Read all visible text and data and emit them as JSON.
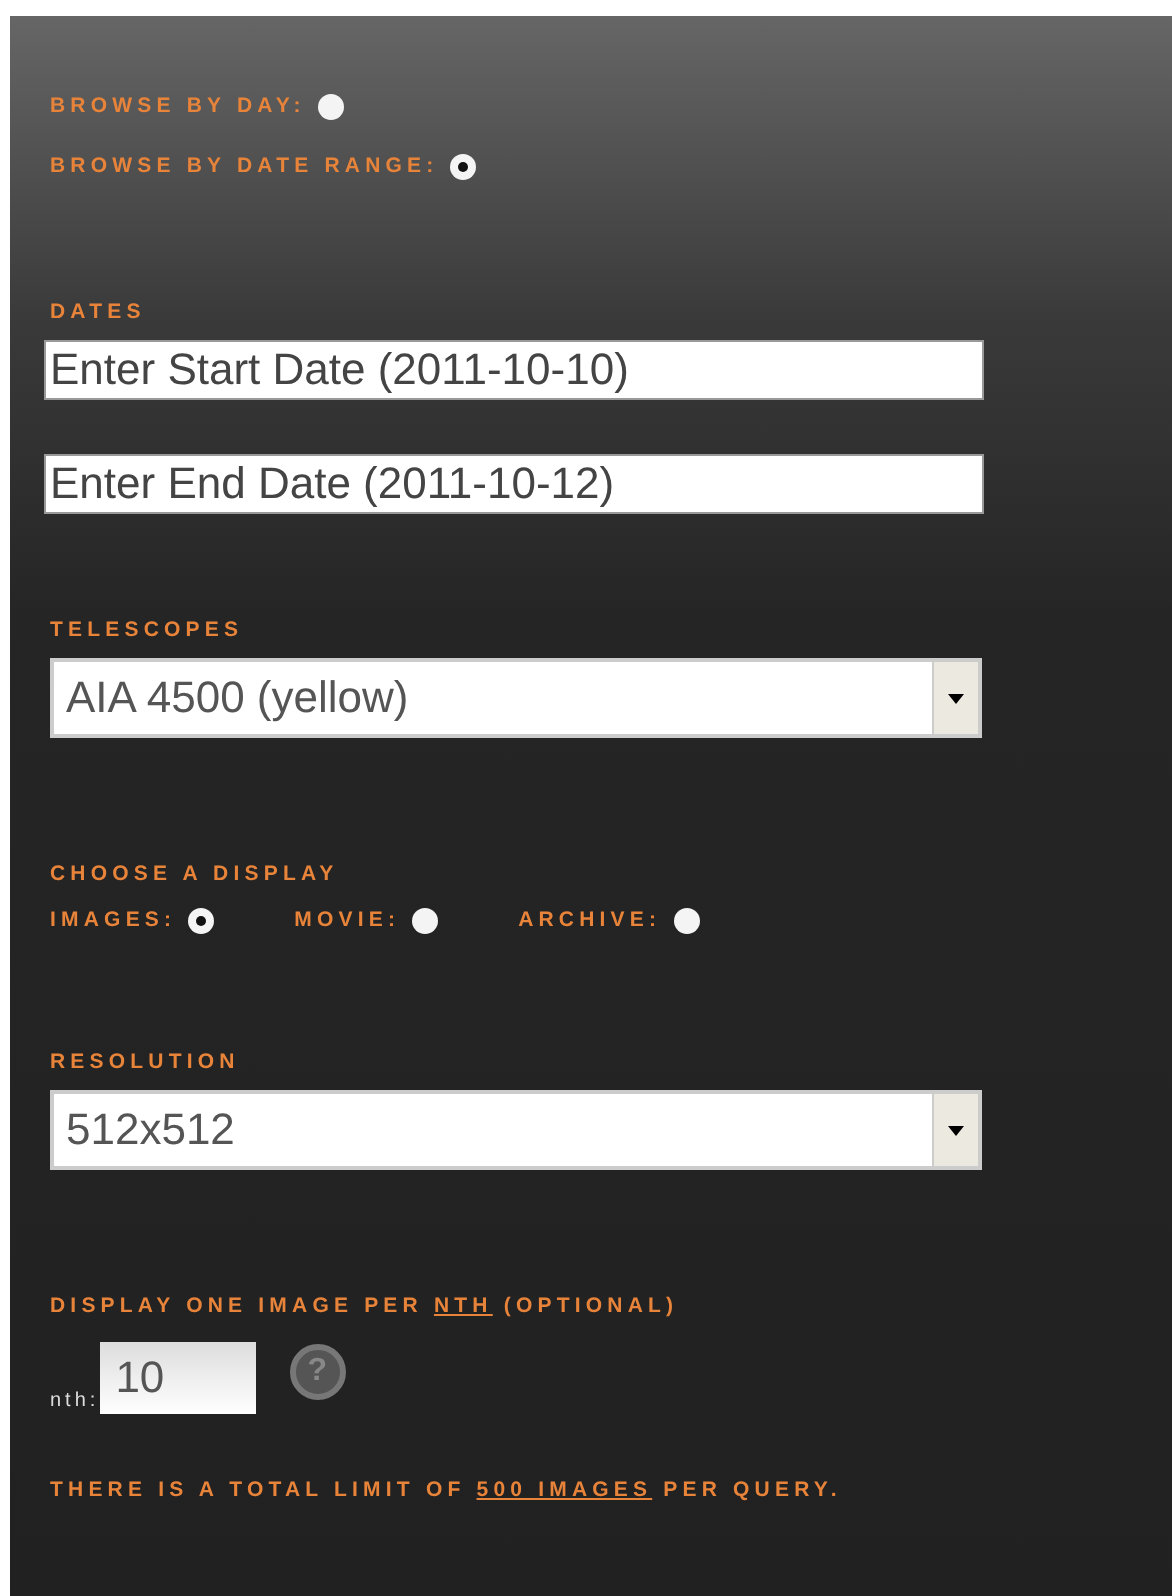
{
  "browse_modes": [
    {
      "label": "BROWSE BY DAY:",
      "selected": false
    },
    {
      "label": "BROWSE BY DATE RANGE:",
      "selected": true
    }
  ],
  "dates": {
    "label": "DATES",
    "start": {
      "value": "Enter Start Date (2011-10-10)"
    },
    "end": {
      "value": "Enter End Date (2011-10-12)"
    }
  },
  "telescopes": {
    "label": "TELESCOPES",
    "value": "AIA 4500 (yellow)"
  },
  "display": {
    "label": "CHOOSE A DISPLAY",
    "options": [
      {
        "label": "IMAGES:",
        "selected": true
      },
      {
        "label": "MOVIE:",
        "selected": false
      },
      {
        "label": "ARCHIVE:",
        "selected": false
      }
    ]
  },
  "resolution": {
    "label": "RESOLUTION",
    "value": "512x512"
  },
  "nth": {
    "heading": "DISPLAY ONE IMAGE PER **NTH** (OPTIONAL)",
    "field_label": "nth:",
    "value": "10",
    "help_icon": "?"
  },
  "limit_note": {
    "before": "THERE IS A TOTAL LIMIT OF ",
    "link": "500 IMAGES",
    "after": " PER QUERY."
  }
}
